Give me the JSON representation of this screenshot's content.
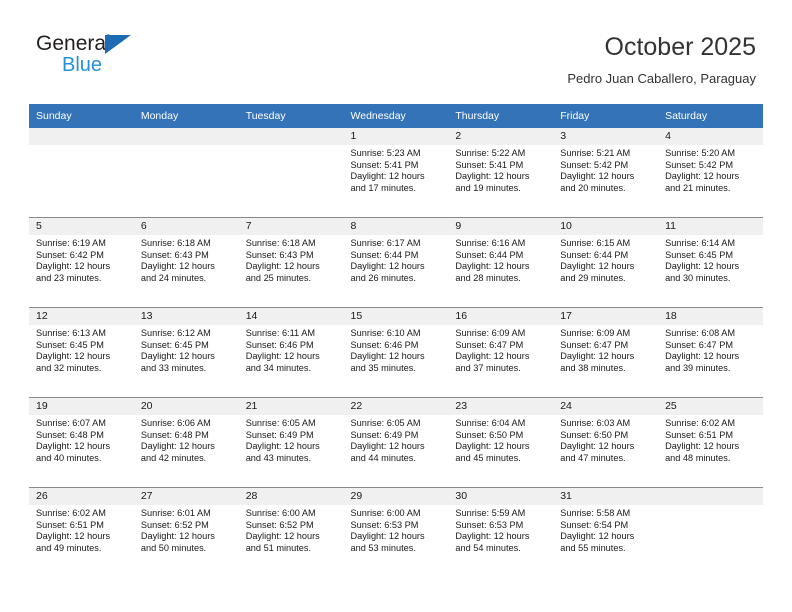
{
  "logo": {
    "word_top": "General",
    "word_bottom": "Blue",
    "triangle_color": "#1b6cb5",
    "blue_text_color": "#2491d8"
  },
  "header": {
    "title": "October 2025",
    "subtitle": "Pedro Juan Caballero, Paraguay",
    "header_bg": "#3573b9"
  },
  "weekday_headers": [
    "Sunday",
    "Monday",
    "Tuesday",
    "Wednesday",
    "Thursday",
    "Friday",
    "Saturday"
  ],
  "weeks": [
    [
      {
        "day": "",
        "sunrise": "",
        "sunset": "",
        "daylight_1": "",
        "daylight_2": ""
      },
      {
        "day": "",
        "sunrise": "",
        "sunset": "",
        "daylight_1": "",
        "daylight_2": ""
      },
      {
        "day": "",
        "sunrise": "",
        "sunset": "",
        "daylight_1": "",
        "daylight_2": ""
      },
      {
        "day": "1",
        "sunrise": "Sunrise: 5:23 AM",
        "sunset": "Sunset: 5:41 PM",
        "daylight_1": "Daylight: 12 hours",
        "daylight_2": "and 17 minutes."
      },
      {
        "day": "2",
        "sunrise": "Sunrise: 5:22 AM",
        "sunset": "Sunset: 5:41 PM",
        "daylight_1": "Daylight: 12 hours",
        "daylight_2": "and 19 minutes."
      },
      {
        "day": "3",
        "sunrise": "Sunrise: 5:21 AM",
        "sunset": "Sunset: 5:42 PM",
        "daylight_1": "Daylight: 12 hours",
        "daylight_2": "and 20 minutes."
      },
      {
        "day": "4",
        "sunrise": "Sunrise: 5:20 AM",
        "sunset": "Sunset: 5:42 PM",
        "daylight_1": "Daylight: 12 hours",
        "daylight_2": "and 21 minutes."
      }
    ],
    [
      {
        "day": "5",
        "sunrise": "Sunrise: 6:19 AM",
        "sunset": "Sunset: 6:42 PM",
        "daylight_1": "Daylight: 12 hours",
        "daylight_2": "and 23 minutes."
      },
      {
        "day": "6",
        "sunrise": "Sunrise: 6:18 AM",
        "sunset": "Sunset: 6:43 PM",
        "daylight_1": "Daylight: 12 hours",
        "daylight_2": "and 24 minutes."
      },
      {
        "day": "7",
        "sunrise": "Sunrise: 6:18 AM",
        "sunset": "Sunset: 6:43 PM",
        "daylight_1": "Daylight: 12 hours",
        "daylight_2": "and 25 minutes."
      },
      {
        "day": "8",
        "sunrise": "Sunrise: 6:17 AM",
        "sunset": "Sunset: 6:44 PM",
        "daylight_1": "Daylight: 12 hours",
        "daylight_2": "and 26 minutes."
      },
      {
        "day": "9",
        "sunrise": "Sunrise: 6:16 AM",
        "sunset": "Sunset: 6:44 PM",
        "daylight_1": "Daylight: 12 hours",
        "daylight_2": "and 28 minutes."
      },
      {
        "day": "10",
        "sunrise": "Sunrise: 6:15 AM",
        "sunset": "Sunset: 6:44 PM",
        "daylight_1": "Daylight: 12 hours",
        "daylight_2": "and 29 minutes."
      },
      {
        "day": "11",
        "sunrise": "Sunrise: 6:14 AM",
        "sunset": "Sunset: 6:45 PM",
        "daylight_1": "Daylight: 12 hours",
        "daylight_2": "and 30 minutes."
      }
    ],
    [
      {
        "day": "12",
        "sunrise": "Sunrise: 6:13 AM",
        "sunset": "Sunset: 6:45 PM",
        "daylight_1": "Daylight: 12 hours",
        "daylight_2": "and 32 minutes."
      },
      {
        "day": "13",
        "sunrise": "Sunrise: 6:12 AM",
        "sunset": "Sunset: 6:45 PM",
        "daylight_1": "Daylight: 12 hours",
        "daylight_2": "and 33 minutes."
      },
      {
        "day": "14",
        "sunrise": "Sunrise: 6:11 AM",
        "sunset": "Sunset: 6:46 PM",
        "daylight_1": "Daylight: 12 hours",
        "daylight_2": "and 34 minutes."
      },
      {
        "day": "15",
        "sunrise": "Sunrise: 6:10 AM",
        "sunset": "Sunset: 6:46 PM",
        "daylight_1": "Daylight: 12 hours",
        "daylight_2": "and 35 minutes."
      },
      {
        "day": "16",
        "sunrise": "Sunrise: 6:09 AM",
        "sunset": "Sunset: 6:47 PM",
        "daylight_1": "Daylight: 12 hours",
        "daylight_2": "and 37 minutes."
      },
      {
        "day": "17",
        "sunrise": "Sunrise: 6:09 AM",
        "sunset": "Sunset: 6:47 PM",
        "daylight_1": "Daylight: 12 hours",
        "daylight_2": "and 38 minutes."
      },
      {
        "day": "18",
        "sunrise": "Sunrise: 6:08 AM",
        "sunset": "Sunset: 6:47 PM",
        "daylight_1": "Daylight: 12 hours",
        "daylight_2": "and 39 minutes."
      }
    ],
    [
      {
        "day": "19",
        "sunrise": "Sunrise: 6:07 AM",
        "sunset": "Sunset: 6:48 PM",
        "daylight_1": "Daylight: 12 hours",
        "daylight_2": "and 40 minutes."
      },
      {
        "day": "20",
        "sunrise": "Sunrise: 6:06 AM",
        "sunset": "Sunset: 6:48 PM",
        "daylight_1": "Daylight: 12 hours",
        "daylight_2": "and 42 minutes."
      },
      {
        "day": "21",
        "sunrise": "Sunrise: 6:05 AM",
        "sunset": "Sunset: 6:49 PM",
        "daylight_1": "Daylight: 12 hours",
        "daylight_2": "and 43 minutes."
      },
      {
        "day": "22",
        "sunrise": "Sunrise: 6:05 AM",
        "sunset": "Sunset: 6:49 PM",
        "daylight_1": "Daylight: 12 hours",
        "daylight_2": "and 44 minutes."
      },
      {
        "day": "23",
        "sunrise": "Sunrise: 6:04 AM",
        "sunset": "Sunset: 6:50 PM",
        "daylight_1": "Daylight: 12 hours",
        "daylight_2": "and 45 minutes."
      },
      {
        "day": "24",
        "sunrise": "Sunrise: 6:03 AM",
        "sunset": "Sunset: 6:50 PM",
        "daylight_1": "Daylight: 12 hours",
        "daylight_2": "and 47 minutes."
      },
      {
        "day": "25",
        "sunrise": "Sunrise: 6:02 AM",
        "sunset": "Sunset: 6:51 PM",
        "daylight_1": "Daylight: 12 hours",
        "daylight_2": "and 48 minutes."
      }
    ],
    [
      {
        "day": "26",
        "sunrise": "Sunrise: 6:02 AM",
        "sunset": "Sunset: 6:51 PM",
        "daylight_1": "Daylight: 12 hours",
        "daylight_2": "and 49 minutes."
      },
      {
        "day": "27",
        "sunrise": "Sunrise: 6:01 AM",
        "sunset": "Sunset: 6:52 PM",
        "daylight_1": "Daylight: 12 hours",
        "daylight_2": "and 50 minutes."
      },
      {
        "day": "28",
        "sunrise": "Sunrise: 6:00 AM",
        "sunset": "Sunset: 6:52 PM",
        "daylight_1": "Daylight: 12 hours",
        "daylight_2": "and 51 minutes."
      },
      {
        "day": "29",
        "sunrise": "Sunrise: 6:00 AM",
        "sunset": "Sunset: 6:53 PM",
        "daylight_1": "Daylight: 12 hours",
        "daylight_2": "and 53 minutes."
      },
      {
        "day": "30",
        "sunrise": "Sunrise: 5:59 AM",
        "sunset": "Sunset: 6:53 PM",
        "daylight_1": "Daylight: 12 hours",
        "daylight_2": "and 54 minutes."
      },
      {
        "day": "31",
        "sunrise": "Sunrise: 5:58 AM",
        "sunset": "Sunset: 6:54 PM",
        "daylight_1": "Daylight: 12 hours",
        "daylight_2": "and 55 minutes."
      },
      {
        "day": "",
        "sunrise": "",
        "sunset": "",
        "daylight_1": "",
        "daylight_2": ""
      }
    ]
  ]
}
